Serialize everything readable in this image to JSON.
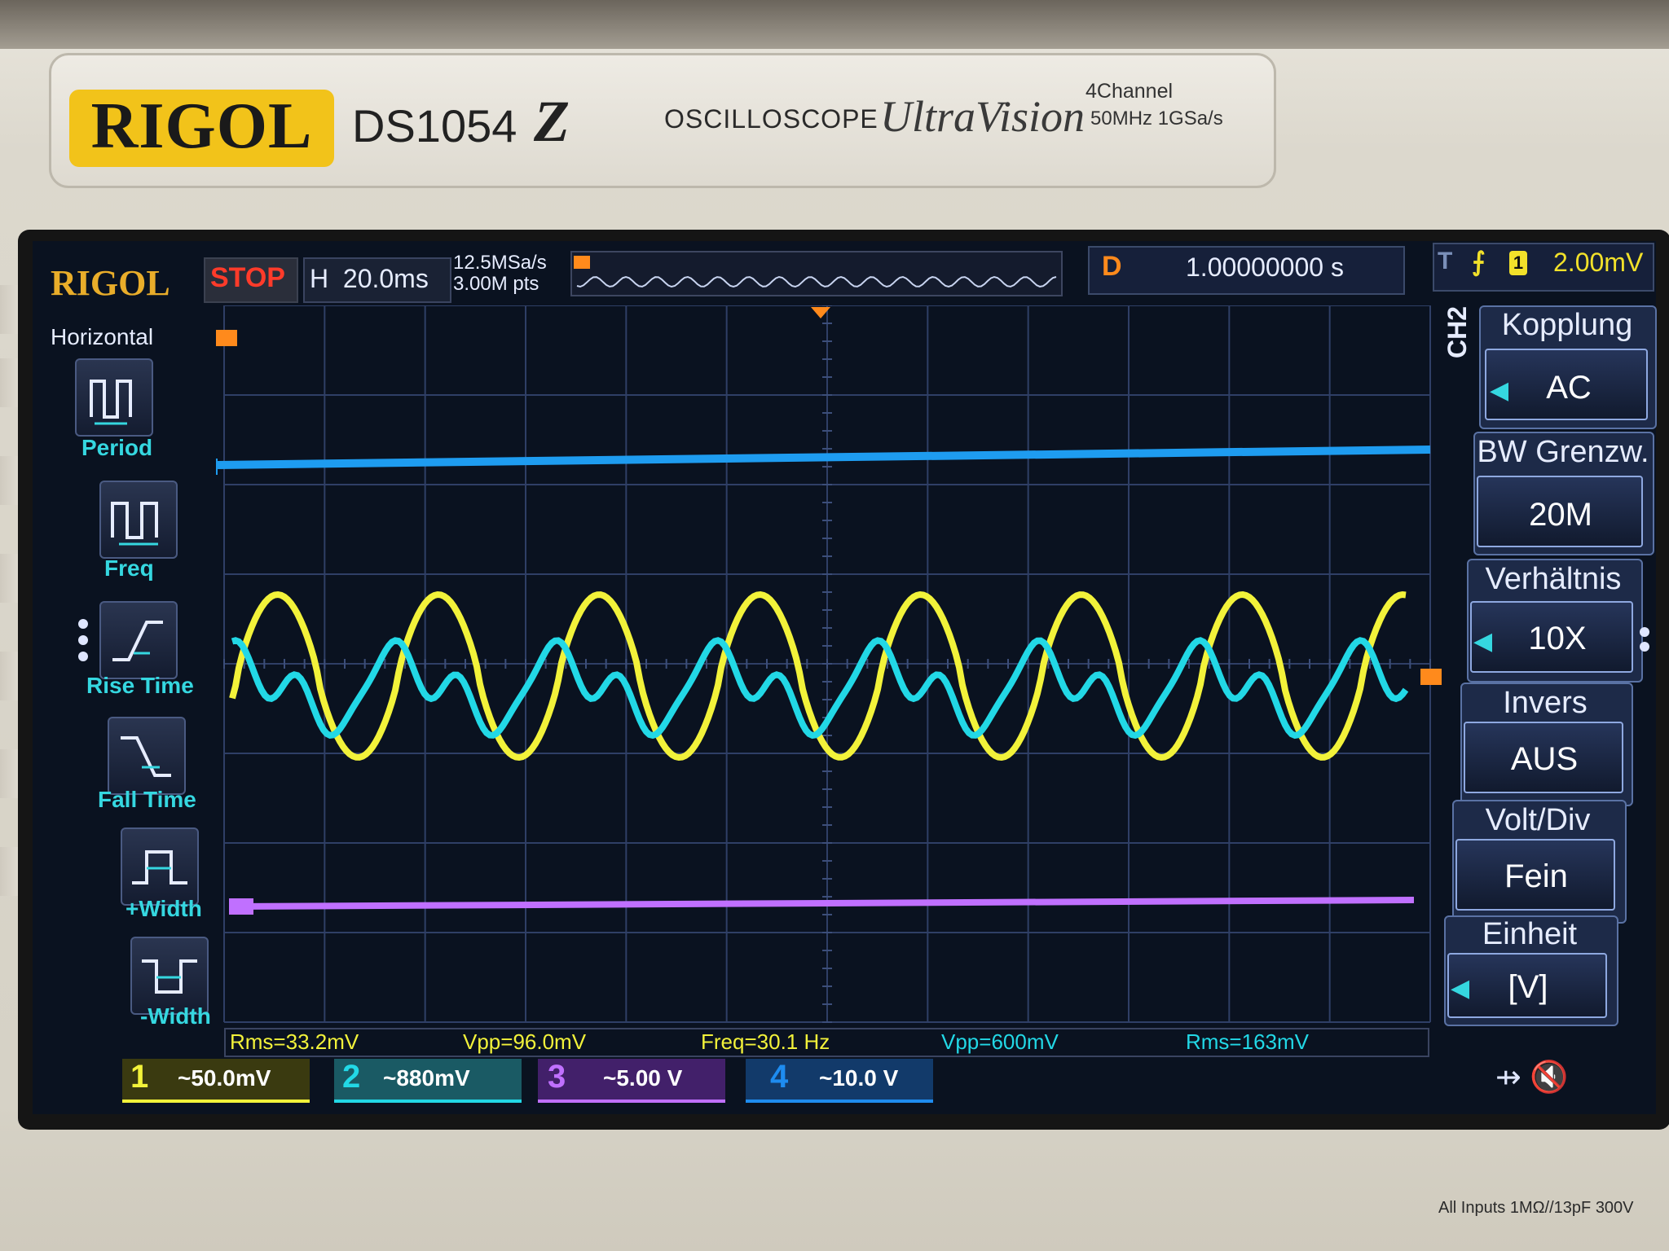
{
  "device": {
    "brand": "RIGOL",
    "model": "DS1054",
    "model_suffix": "Z",
    "type_label": "OSCILLOSCOPE",
    "series": "UltraVision",
    "spec_line1": "4Channel",
    "spec_line2": "50MHz  1GSa/s",
    "input_note": "All Inputs 1MΩ//13pF 300V"
  },
  "colors": {
    "ch1": "#f2f23a",
    "ch2": "#22d8e6",
    "ch3": "#b65cff",
    "ch4": "#1e8cf0",
    "bg": "#0a1220",
    "accent_orange": "#ff8a1c"
  },
  "header": {
    "logo": "RIGOL",
    "run_state": "STOP",
    "h_label": "H",
    "timebase": "20.0ms",
    "sample_rate": "12.5MSa/s",
    "memory_depth": "3.00M pts",
    "delay_label": "D",
    "delay_value": "1.00000000 s",
    "trigger_label": "T",
    "trigger_edge_icon": "rising-edge-icon",
    "trigger_source": "1",
    "trigger_level": "2.00mV"
  },
  "left_menu": {
    "title": "Horizontal",
    "items": [
      {
        "label": "Period",
        "icon": "period-icon"
      },
      {
        "label": "Freq",
        "icon": "freq-icon"
      },
      {
        "label": "Rise Time",
        "icon": "rise-time-icon"
      },
      {
        "label": "Fall Time",
        "icon": "fall-time-icon"
      },
      {
        "label": "+Width",
        "icon": "pos-width-icon"
      },
      {
        "label": "-Width",
        "icon": "neg-width-icon"
      }
    ]
  },
  "right_menu": {
    "channel_tag": "CH2",
    "items": [
      {
        "title": "Kopplung",
        "value": "AC"
      },
      {
        "title": "BW Grenzw.",
        "value": "20M"
      },
      {
        "title": "Verhältnis",
        "value": "10X"
      },
      {
        "title": "Invers",
        "value": "AUS"
      },
      {
        "title": "Volt/Div",
        "value": "Fein"
      },
      {
        "title": "Einheit",
        "value": "[V]"
      }
    ]
  },
  "measurements": [
    "Rms=33.2mV",
    "Vpp=96.0mV",
    "Freq=30.1 Hz",
    "Vpp=600mV",
    "Rms=163mV"
  ],
  "channels": [
    {
      "num": "1",
      "scale": "~50.0mV"
    },
    {
      "num": "2",
      "scale": "~880mV"
    },
    {
      "num": "3",
      "scale": "~5.00 V"
    },
    {
      "num": "4",
      "scale": "~10.0 V"
    }
  ],
  "traces": {
    "frequency_hz": 30.1,
    "ch1_vpp": "96.0mV",
    "ch2_vpp": "600mV"
  }
}
